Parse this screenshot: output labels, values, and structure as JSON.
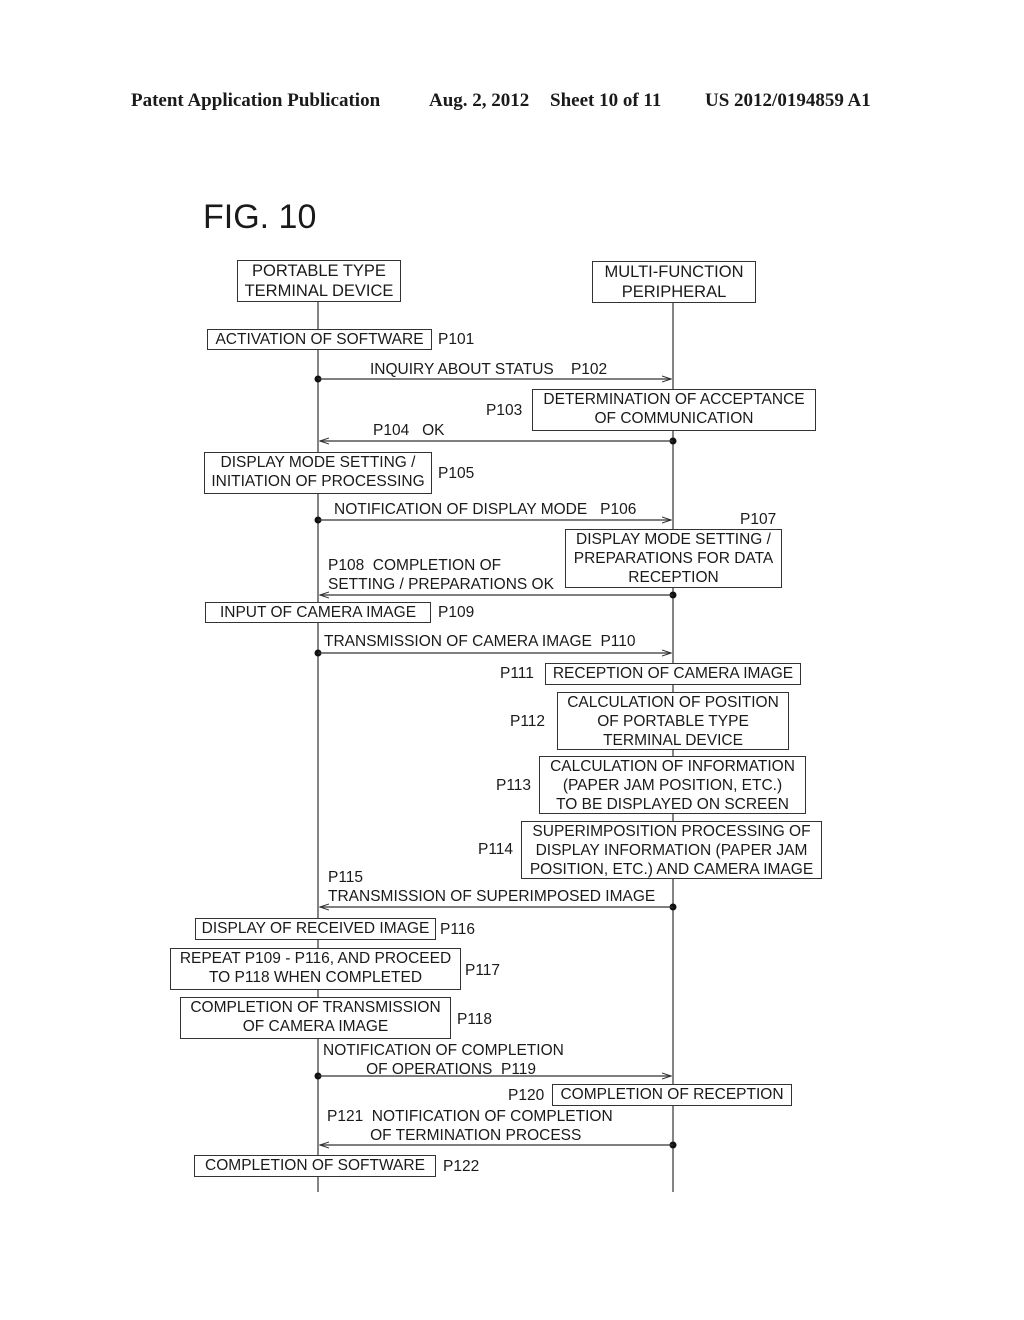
{
  "header": {
    "publication": "Patent Application Publication",
    "date": "Aug. 2, 2012",
    "sheet": "Sheet 10 of 11",
    "number": "US 2012/0194859 A1"
  },
  "figure": {
    "title": "FIG. 10",
    "lanes": {
      "left": "PORTABLE TYPE\nTERMINAL DEVICE",
      "right": "MULTI-FUNCTION\nPERIPHERAL"
    },
    "steps": {
      "p101": {
        "id": "P101",
        "text": "ACTIVATION OF SOFTWARE"
      },
      "p102": {
        "id": "P102",
        "text": "INQUIRY ABOUT STATUS    P102"
      },
      "p103": {
        "id": "P103",
        "text": "DETERMINATION OF ACCEPTANCE\nOF COMMUNICATION"
      },
      "p104": {
        "id": "P104",
        "text": "P104   OK"
      },
      "p105": {
        "id": "P105",
        "text": "DISPLAY MODE SETTING /\nINITIATION OF PROCESSING"
      },
      "p106": {
        "id": "P106",
        "text": "NOTIFICATION OF DISPLAY MODE   P106"
      },
      "p107": {
        "id": "P107",
        "text": "DISPLAY MODE SETTING /\nPREPARATIONS FOR DATA\nRECEPTION"
      },
      "p108": {
        "id": "P108",
        "text": "P108  COMPLETION OF\nSETTING / PREPARATIONS OK"
      },
      "p109": {
        "id": "P109",
        "text": "INPUT OF CAMERA IMAGE"
      },
      "p110": {
        "id": "P110",
        "text": "TRANSMISSION OF CAMERA IMAGE  P110"
      },
      "p111": {
        "id": "P111",
        "text": "RECEPTION OF CAMERA IMAGE"
      },
      "p112": {
        "id": "P112",
        "text": "CALCULATION OF POSITION\nOF PORTABLE TYPE\nTERMINAL  DEVICE"
      },
      "p113": {
        "id": "P113",
        "text": "CALCULATION OF INFORMATION\n(PAPER JAM POSITION, ETC.)\nTO BE DISPLAYED ON SCREEN"
      },
      "p114": {
        "id": "P114",
        "text": "SUPERIMPOSITION PROCESSING OF\nDISPLAY INFORMATION (PAPER JAM\nPOSITION, ETC.) AND CAMERA IMAGE"
      },
      "p115": {
        "id": "P115",
        "text": "P115\nTRANSMISSION OF SUPERIMPOSED IMAGE"
      },
      "p116": {
        "id": "P116",
        "text": "DISPLAY OF RECEIVED IMAGE"
      },
      "p117": {
        "id": "P117",
        "text": "REPEAT P109 - P116, AND PROCEED\nTO P118 WHEN COMPLETED"
      },
      "p118": {
        "id": "P118",
        "text": "COMPLETION OF TRANSMISSION\nOF CAMERA IMAGE"
      },
      "p119": {
        "id": "P119",
        "text": "NOTIFICATION OF COMPLETION\n          OF OPERATIONS  P119"
      },
      "p120": {
        "id": "P120",
        "text": "COMPLETION OF RECEPTION"
      },
      "p121": {
        "id": "P121",
        "text": "P121  NOTIFICATION OF COMPLETION\n          OF TERMINATION PROCESS"
      },
      "p122": {
        "id": "P122",
        "text": "COMPLETION OF SOFTWARE"
      }
    }
  }
}
